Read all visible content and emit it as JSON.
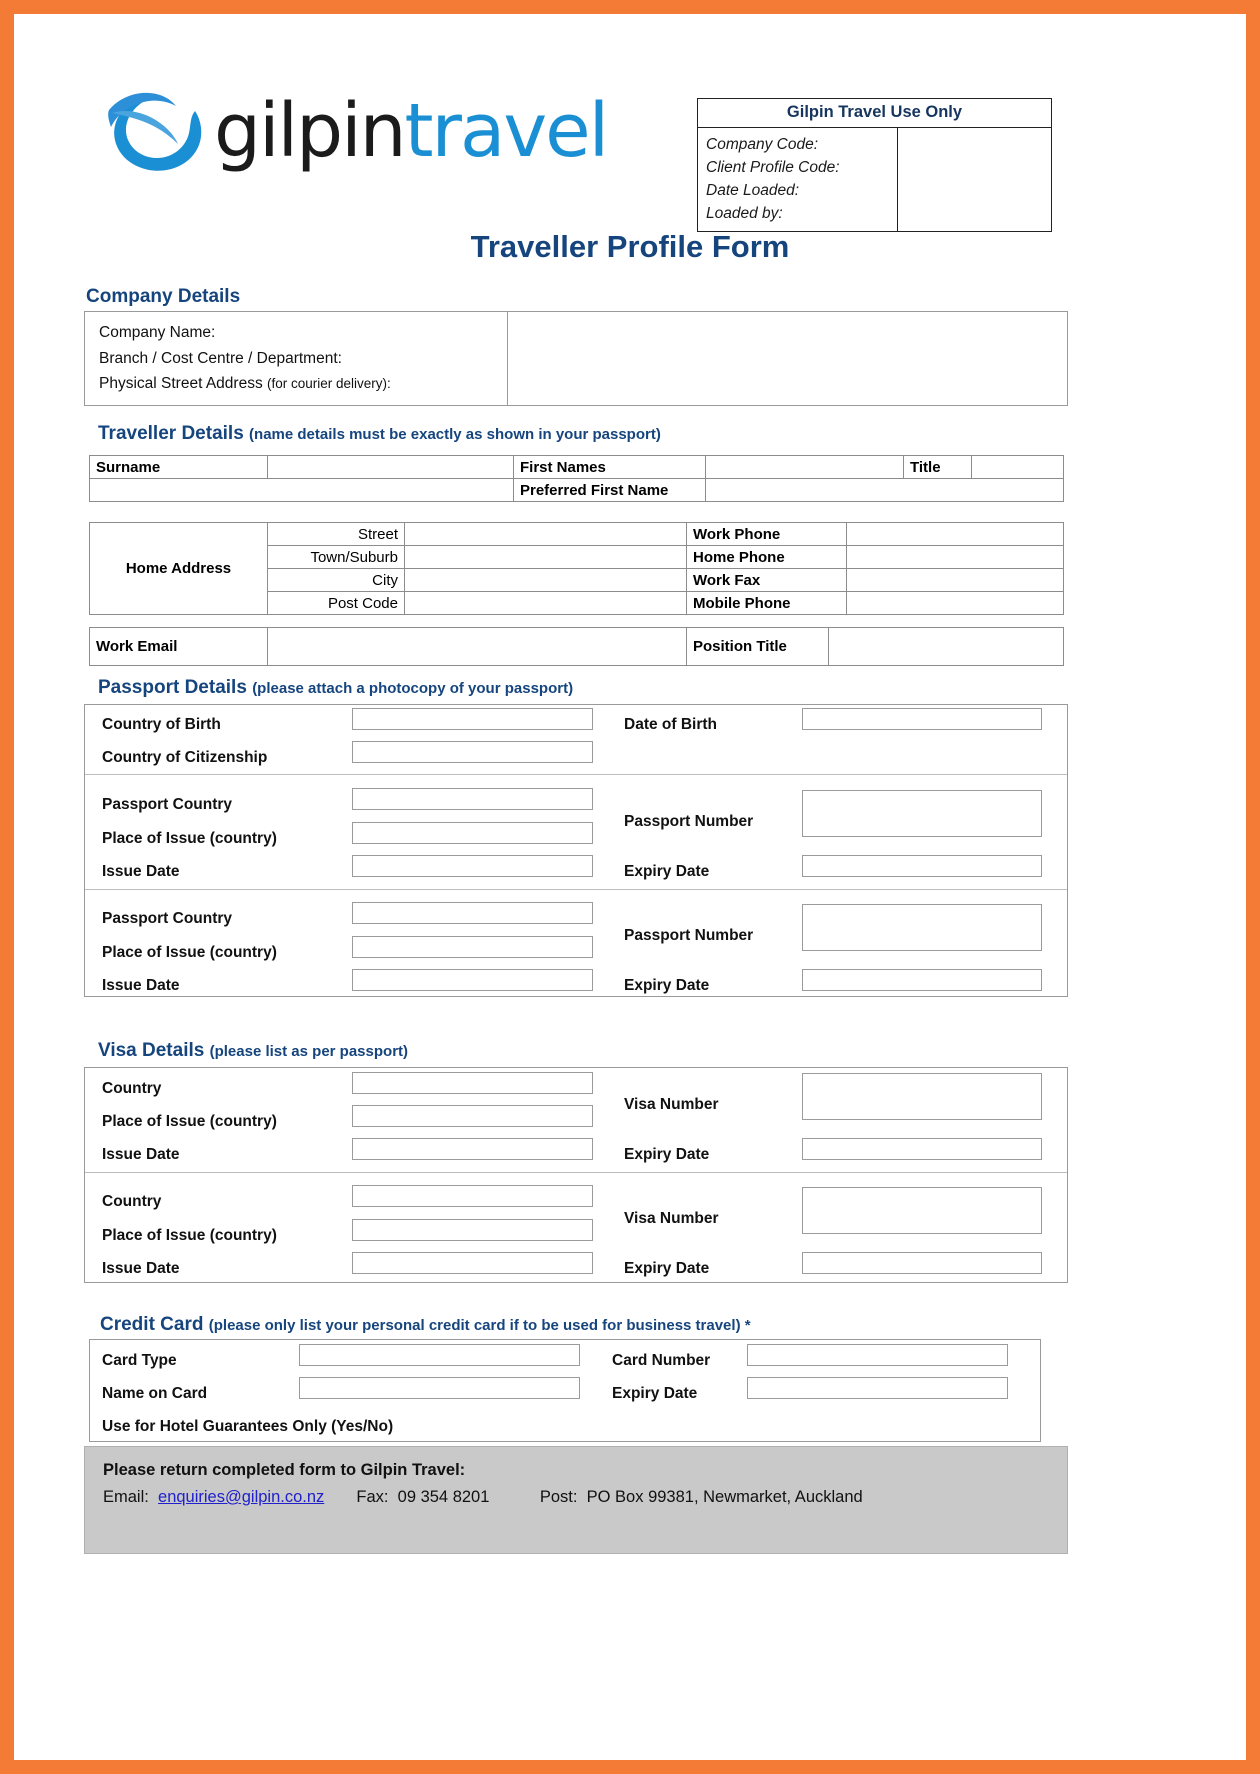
{
  "brand": {
    "logo_text_dark": "gilpin",
    "logo_text_blue": "travel",
    "accent_orange": "#f47b36",
    "heading_blue": "#16457e",
    "logo_blue": "#1b8fd4"
  },
  "use_only": {
    "title": "Gilpin Travel Use Only",
    "labels": [
      "Company Code:",
      "Client Profile Code:",
      "Date Loaded:",
      "Loaded by:"
    ]
  },
  "form_title": "Traveller Profile Form",
  "company": {
    "heading": "Company Details",
    "lines": [
      "Company Name:",
      "Branch / Cost Centre / Department:",
      "Physical Street Address (for courier delivery):"
    ],
    "address_label_main": "Physical Street Address",
    "address_label_note": "(for courier delivery):"
  },
  "traveller": {
    "heading": "Traveller Details",
    "note": "(name details must be exactly as shown in your passport)",
    "surname_label": "Surname",
    "first_names_label": "First Names",
    "title_label": "Title",
    "preferred_label": "Preferred First Name",
    "home_address_label": "Home Address",
    "address_rows": [
      "Street",
      "Town/Suburb",
      "City",
      "Post Code"
    ],
    "phone_rows": [
      "Work Phone",
      "Home Phone",
      "Work Fax",
      "Mobile Phone"
    ],
    "work_email_label": "Work Email",
    "position_title_label": "Position Title"
  },
  "passport": {
    "heading": "Passport Details",
    "note": "(please attach a photocopy of your passport)",
    "country_of_birth": "Country of Birth",
    "country_of_citizenship": "Country of Citizenship",
    "date_of_birth": "Date of Birth",
    "blocks": [
      {
        "passport_country": "Passport Country",
        "place_of_issue": "Place of Issue (country)",
        "issue_date": "Issue Date",
        "passport_number": "Passport Number",
        "expiry_date": "Expiry Date"
      },
      {
        "passport_country": "Passport Country",
        "place_of_issue": "Place of Issue (country)",
        "issue_date": "Issue Date",
        "passport_number": "Passport Number",
        "expiry_date": "Expiry Date"
      }
    ]
  },
  "visa": {
    "heading": "Visa Details",
    "note": "(please list as per passport)",
    "blocks": [
      {
        "country": "Country",
        "place_of_issue": "Place of Issue (country)",
        "issue_date": "Issue Date",
        "visa_number": "Visa Number",
        "expiry_date": "Expiry Date"
      },
      {
        "country": "Country",
        "place_of_issue": "Place of Issue (country)",
        "issue_date": "Issue Date",
        "visa_number": "Visa Number",
        "expiry_date": "Expiry Date"
      }
    ]
  },
  "credit_card": {
    "heading": "Credit Card",
    "note": "(please only list your personal credit card if to be used for business travel) *",
    "card_type": "Card Type",
    "name_on_card": "Name on Card",
    "card_number": "Card Number",
    "expiry_date": "Expiry Date",
    "hotel_guarantees": "Use for Hotel Guarantees Only (Yes/No)"
  },
  "footer": {
    "title": "Please return completed form to Gilpin Travel:",
    "email_label": "Email:",
    "email": "enquiries@gilpin.co.nz",
    "fax_label": "Fax:",
    "fax": "09 354 8201",
    "post_label": "Post:",
    "post": "PO Box 99381, Newmarket, Auckland"
  }
}
